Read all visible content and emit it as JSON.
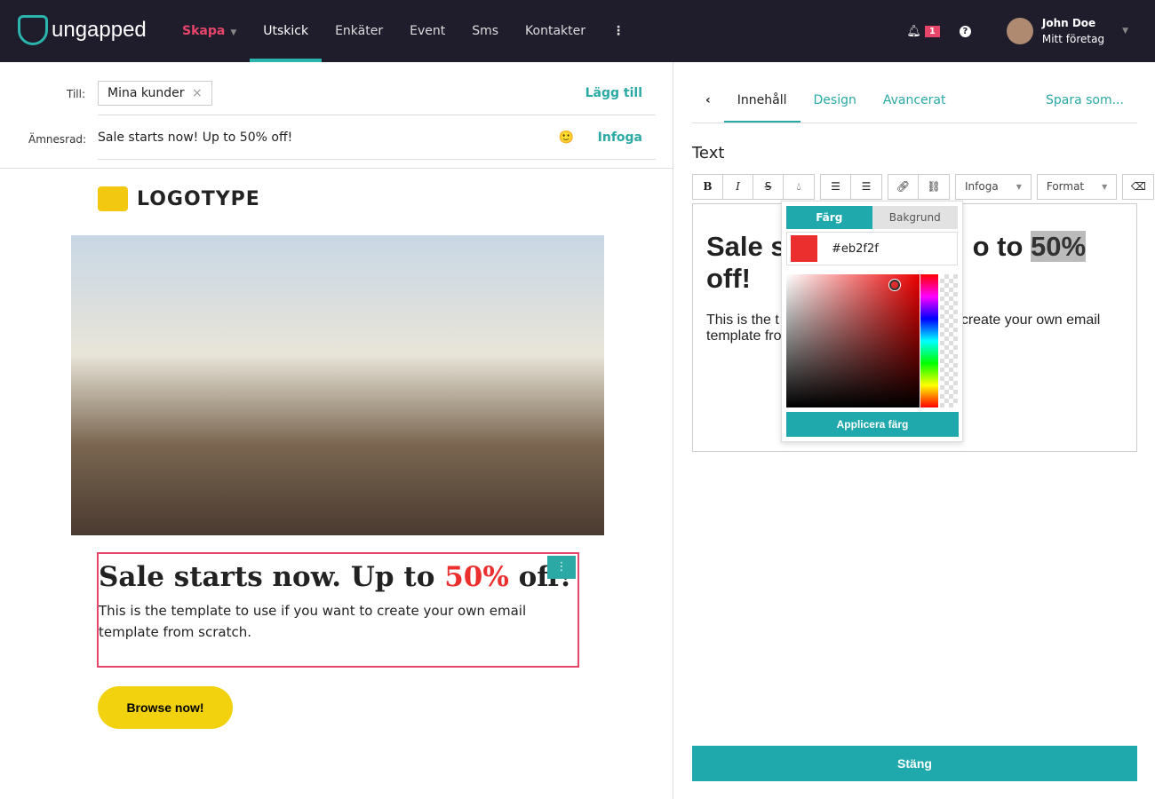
{
  "nav": {
    "brand": "ungapped",
    "items": [
      "Skapa",
      "Utskick",
      "Enkäter",
      "Event",
      "Sms",
      "Kontakter"
    ],
    "more": "⋮",
    "notifications": "1",
    "help": "?",
    "user_name": "John Doe",
    "company": "Mitt företag"
  },
  "composer": {
    "to_label": "Till:",
    "recipient": "Mina kunder",
    "add_link": "Lägg till",
    "subject_label": "Ämnesrad:",
    "subject": "Sale starts now! Up to 50% off!",
    "insert_link": "Infoga",
    "emoji": "🙂"
  },
  "email": {
    "logo": "LOGOTYPE",
    "headline_a": "Sale starts now. Up to ",
    "headline_b": "50%",
    "headline_c": " off!",
    "body": "This is the template to use if you want to create your own email template from scratch.",
    "button": "Browse now!",
    "accent": "#eb2f2f"
  },
  "panel": {
    "tabs": [
      "Innehåll",
      "Design",
      "Avancerat"
    ],
    "save_as": "Spara som...",
    "title": "Text",
    "toolbar": {
      "insert": "Infoga",
      "format": "Format"
    },
    "editor": {
      "h_a": "Sale s",
      "h_b": "o to ",
      "h_c": "50%",
      "h_d": " off!",
      "p_a": "This is the t",
      "p_b": "create your own email",
      "p_c": "template fro"
    },
    "picker": {
      "tab_color": "Färg",
      "tab_bg": "Bakgrund",
      "hex": "#eb2f2f",
      "apply": "Applicera färg"
    },
    "close": "Stäng"
  }
}
